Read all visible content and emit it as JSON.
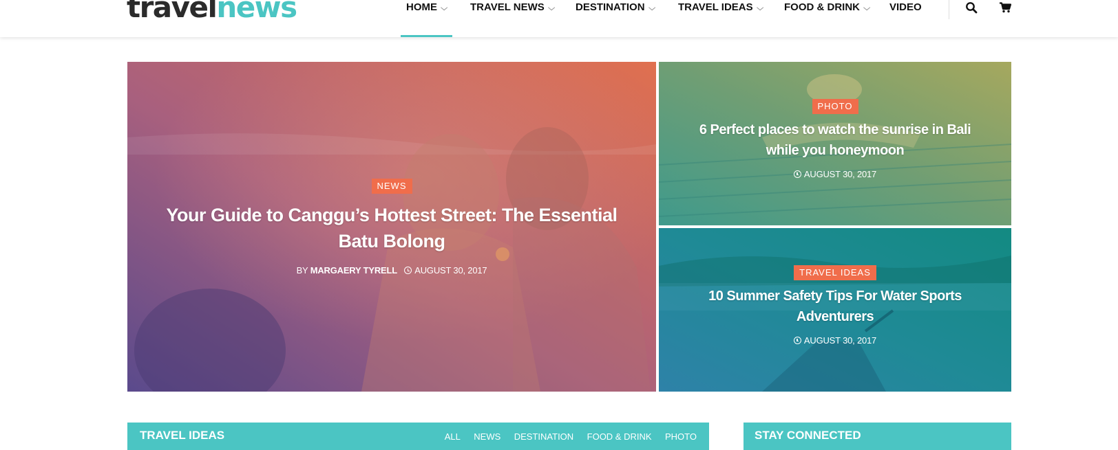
{
  "logo": {
    "part1": "travel",
    "part2": "news"
  },
  "nav": {
    "items": [
      {
        "label": "HOME",
        "chevron": true,
        "active": true
      },
      {
        "label": "TRAVEL NEWS",
        "chevron": true,
        "active": false
      },
      {
        "label": "DESTINATION",
        "chevron": true,
        "active": false
      },
      {
        "label": "TRAVEL IDEAS",
        "chevron": true,
        "active": false
      },
      {
        "label": "FOOD & DRINK",
        "chevron": true,
        "active": false
      },
      {
        "label": "VIDEO",
        "chevron": false,
        "active": false
      }
    ],
    "icons": [
      "search-icon",
      "cart-icon"
    ]
  },
  "featured": {
    "main": {
      "category": "NEWS",
      "title_line1": "Your Guide to Canggu’s Hottest Street: The Essential",
      "title_line2": "Batu Bolong",
      "by": "BY",
      "author": "MARGAERY TYRELL",
      "date": "AUGUST 30, 2017"
    },
    "side1": {
      "category": "PHOTO",
      "title_line1": "6 Perfect places to watch the sunrise in Bali",
      "title_line2": "while you honeymoon",
      "date": "AUGUST 30, 2017"
    },
    "side2": {
      "category": "TRAVEL IDEAS",
      "title_line1": "10 Summer Safety Tips For Water Sports",
      "title_line2": "Adventurers",
      "date": "AUGUST 30, 2017"
    }
  },
  "travel_ideas_section": {
    "title": "TRAVEL IDEAS",
    "tabs": [
      "ALL",
      "NEWS",
      "DESTINATION",
      "FOOD & DRINK",
      "PHOTO"
    ]
  },
  "stay_connected": {
    "title": "STAY CONNECTED"
  },
  "colors": {
    "accent": "#4bc5c3",
    "badge": "#f06d4b",
    "text": "#111111"
  }
}
